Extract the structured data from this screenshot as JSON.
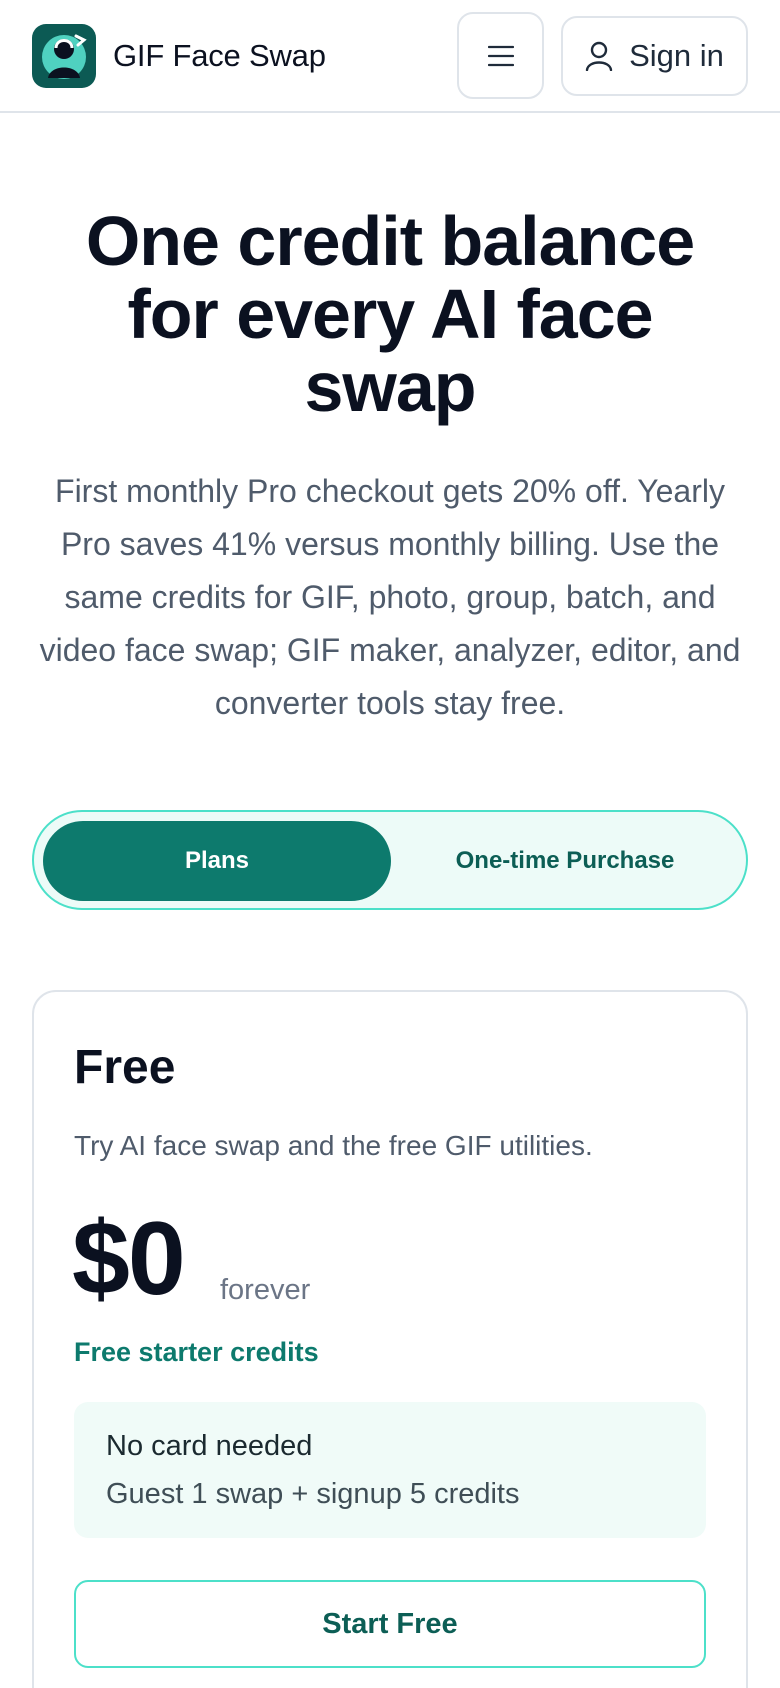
{
  "header": {
    "brand": "GIF Face Swap",
    "logo_icon": "face-swap-logo-icon",
    "menu_icon": "hamburger-menu-icon",
    "signin_label": "Sign in",
    "signin_icon": "user-icon"
  },
  "hero": {
    "title": "One credit balance for every AI face swap",
    "subtitle": "First monthly Pro checkout gets 20% off. Yearly Pro saves 41% versus monthly billing. Use the same credits for GIF, photo, group, batch, and video face swap; GIF maker, analyzer, editor, and converter tools stay free."
  },
  "pricing_toggle": {
    "options": [
      "Plans",
      "One-time Purchase"
    ],
    "selected": "Plans"
  },
  "plan_card": {
    "name": "Free",
    "description": "Try AI face swap and the free GIF utilities.",
    "price": "$0",
    "period": "forever",
    "credits_label": "Free starter credits",
    "note_title": "No card needed",
    "note_text": "Guest 1 swap + signup 5 credits",
    "cta_label": "Start Free"
  },
  "colors": {
    "accent": "#0d7a6d",
    "accent_border": "#4ce0c9",
    "accent_bg": "#edfbf8",
    "text_dark": "#0b1120",
    "text_muted": "#4f5b6b"
  }
}
